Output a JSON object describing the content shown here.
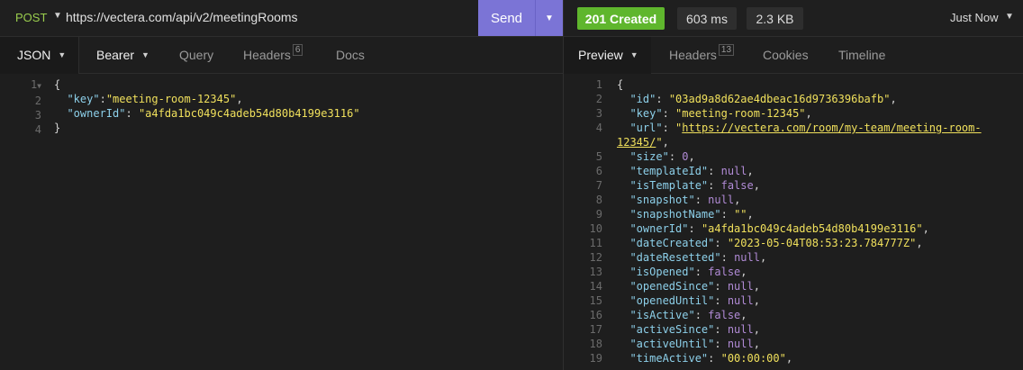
{
  "request": {
    "method": "POST",
    "url": "https://vectera.com/api/v2/meetingRooms",
    "send_label": "Send"
  },
  "response_meta": {
    "status": "201 Created",
    "time": "603 ms",
    "size": "2.3 KB",
    "history": "Just Now"
  },
  "colors": {
    "status_green": "#5fb62d",
    "send_purple": "#7b74d6",
    "key_color": "#8dd0ea",
    "string_color": "#f0e05c",
    "literal_color": "#b18bd6"
  },
  "icons": {
    "caret": "chevron-down-icon",
    "fold": "fold-arrow-icon"
  },
  "left_tabs": {
    "body": "JSON",
    "auth": "Bearer",
    "query": "Query",
    "headers": "Headers",
    "headers_count": "6",
    "docs": "Docs"
  },
  "right_tabs": {
    "preview": "Preview",
    "headers": "Headers",
    "headers_count": "13",
    "cookies": "Cookies",
    "timeline": "Timeline"
  },
  "request_body": {
    "line_numbers": [
      "1",
      "2",
      "3",
      "4"
    ],
    "open": "{",
    "close": "}",
    "key_key": "\"key\"",
    "key_val": "\"meeting-room-12345\"",
    "owner_key": "\"ownerId\"",
    "owner_val": "\"a4fda1bc049c4adeb54d80b4199e3116\""
  },
  "response_body": {
    "line_numbers": [
      "1",
      "2",
      "3",
      "4",
      "",
      "5",
      "6",
      "7",
      "8",
      "9",
      "10",
      "11",
      "12",
      "13",
      "14",
      "15",
      "16",
      "17",
      "18",
      "19"
    ],
    "open": "{",
    "url_line1": "https://vectera.com/room/my-team/meeting-room-",
    "url_line2": "12345/",
    "lines": [
      {
        "key": "\"id\"",
        "value": "\"03ad9a8d62ae4dbeac16d9736396bafb\"",
        "type": "s"
      },
      {
        "key": "\"key\"",
        "value": "\"meeting-room-12345\"",
        "type": "s"
      },
      {
        "key": "\"url\"",
        "value": "\"",
        "type": "url"
      },
      {
        "key": "\"size\"",
        "value": "0",
        "type": "n"
      },
      {
        "key": "\"templateId\"",
        "value": "null",
        "type": "lit"
      },
      {
        "key": "\"isTemplate\"",
        "value": "false",
        "type": "lit"
      },
      {
        "key": "\"snapshot\"",
        "value": "null",
        "type": "lit"
      },
      {
        "key": "\"snapshotName\"",
        "value": "\"\"",
        "type": "s"
      },
      {
        "key": "\"ownerId\"",
        "value": "\"a4fda1bc049c4adeb54d80b4199e3116\"",
        "type": "s"
      },
      {
        "key": "\"dateCreated\"",
        "value": "\"2023-05-04T08:53:23.784777Z\"",
        "type": "s"
      },
      {
        "key": "\"dateResetted\"",
        "value": "null",
        "type": "lit"
      },
      {
        "key": "\"isOpened\"",
        "value": "false",
        "type": "lit"
      },
      {
        "key": "\"openedSince\"",
        "value": "null",
        "type": "lit"
      },
      {
        "key": "\"openedUntil\"",
        "value": "null",
        "type": "lit"
      },
      {
        "key": "\"isActive\"",
        "value": "false",
        "type": "lit"
      },
      {
        "key": "\"activeSince\"",
        "value": "null",
        "type": "lit"
      },
      {
        "key": "\"activeUntil\"",
        "value": "null",
        "type": "lit"
      },
      {
        "key": "\"timeActive\"",
        "value": "\"00:00:00\"",
        "type": "s"
      }
    ]
  }
}
